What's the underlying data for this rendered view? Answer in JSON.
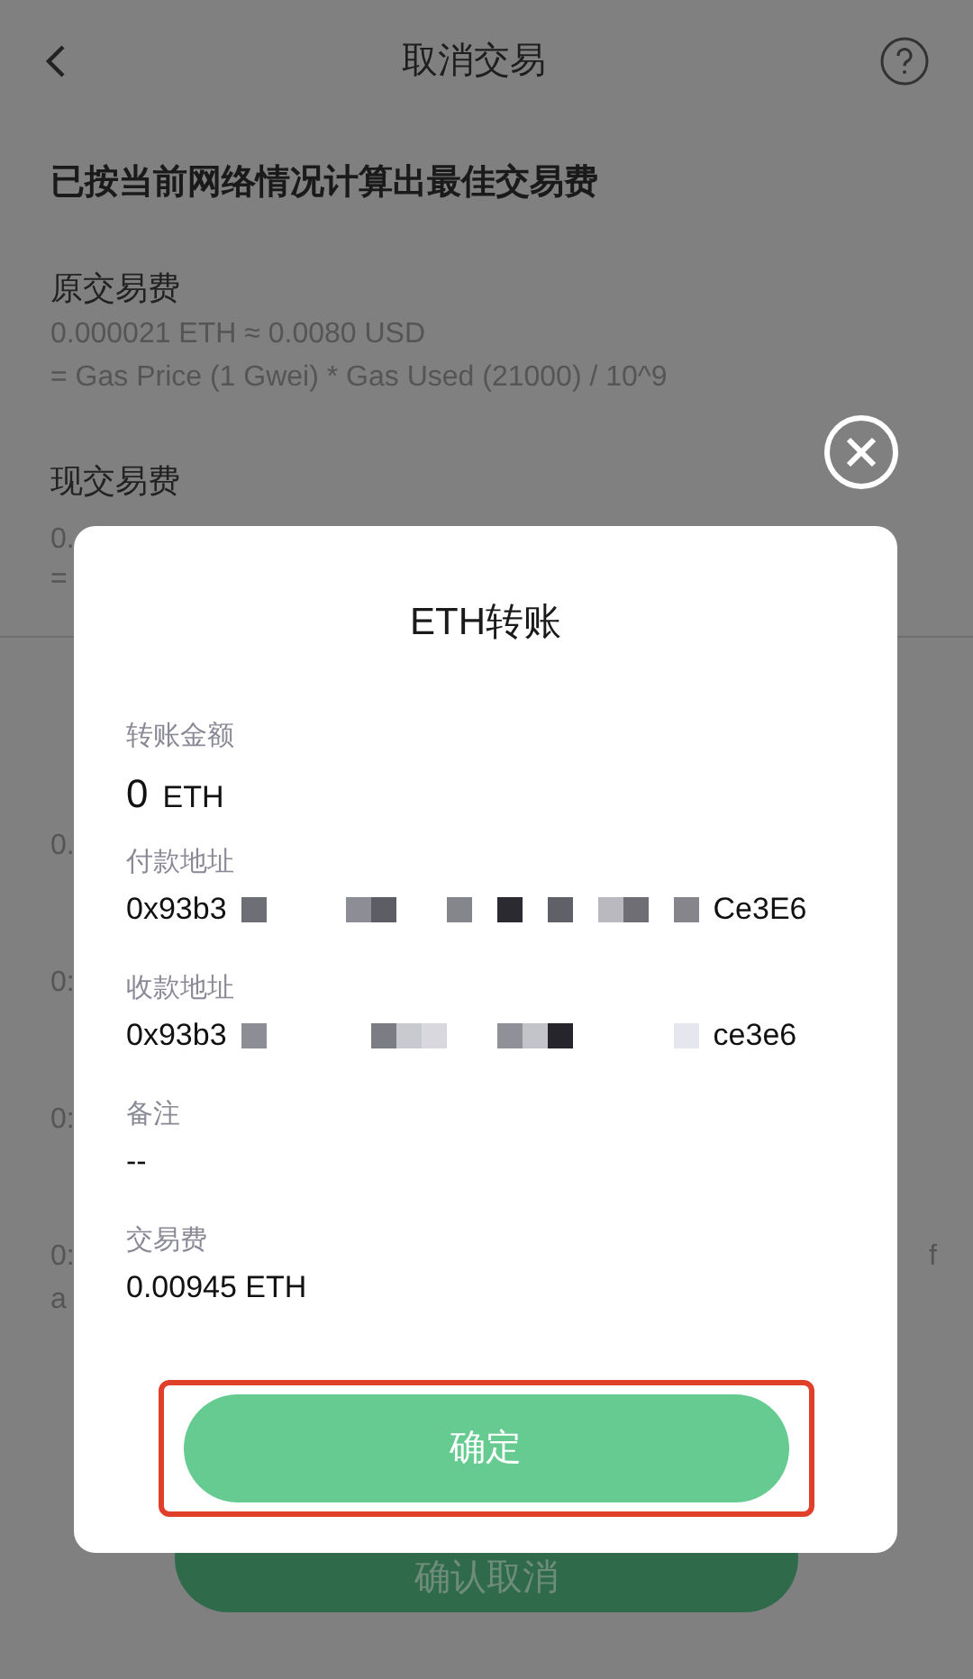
{
  "header": {
    "title": "取消交易"
  },
  "notice": "已按当前网络情况计算出最佳交易费",
  "original_fee": {
    "label": "原交易费",
    "lines": [
      "0.000021 ETH ≈ 0.0080 USD",
      "= Gas Price (1 Gwei) * Gas Used (21000) / 10^9"
    ]
  },
  "current_fee": {
    "label": "现交易费",
    "lines": [
      "0.",
      "="
    ]
  },
  "details": {
    "fields": [
      {
        "value": "0."
      },
      {
        "value": "0:"
      },
      {
        "value": "0:"
      },
      {
        "value": "0:",
        "value_end": "f",
        "value_line_2": "a"
      }
    ]
  },
  "confirm_cancel_button": "确认取消",
  "dialog": {
    "title": "ETH转账",
    "highlighted": true,
    "confirm_button": "确定",
    "fields": [
      {
        "kind": "amount",
        "label": "转账金额",
        "amount": "0",
        "unit": "ETH"
      },
      {
        "kind": "address",
        "label": "付款地址",
        "start": "0x93b3",
        "end": "Ce3E6"
      },
      {
        "kind": "address",
        "label": "收款地址",
        "start": "0x93b3",
        "end": "ce3e6"
      },
      {
        "kind": "text",
        "label": "备注",
        "value": "--"
      },
      {
        "kind": "text",
        "label": "交易费",
        "value": "0.00945 ETH"
      }
    ]
  }
}
